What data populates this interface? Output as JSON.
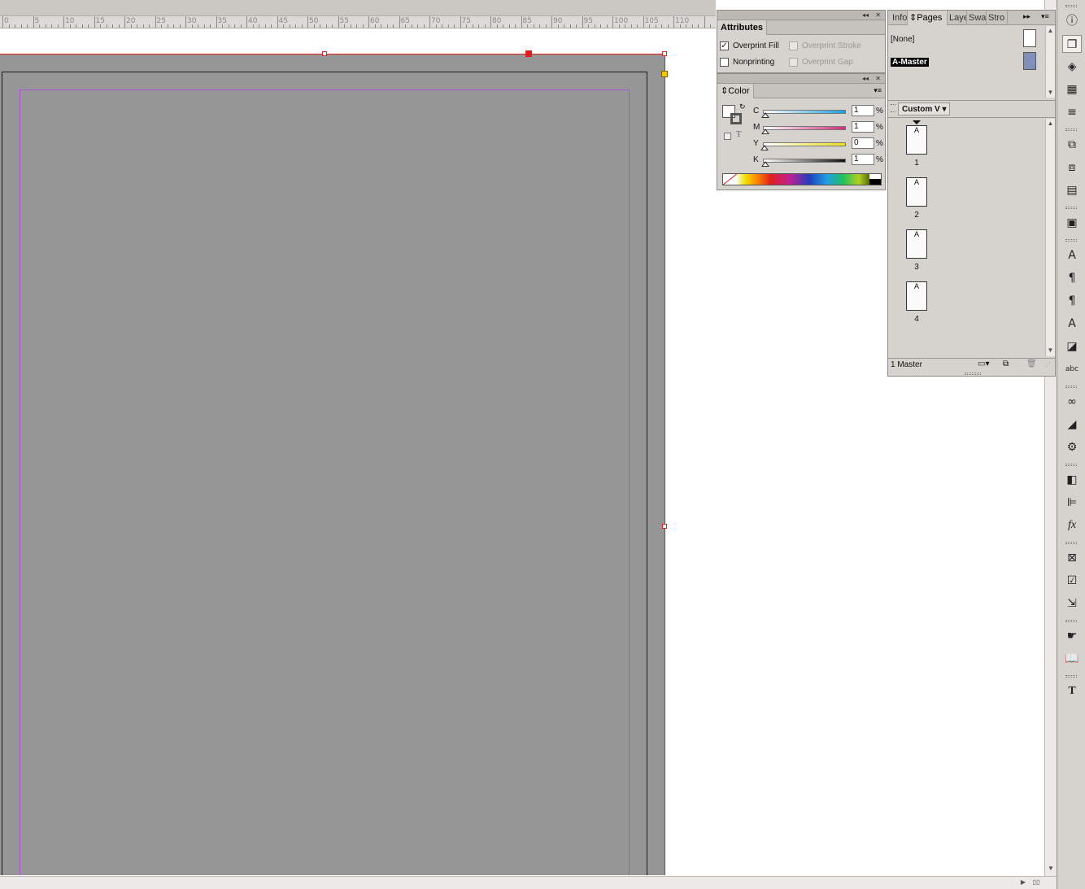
{
  "ruler": {
    "labels": [
      "0",
      "5",
      "10",
      "15",
      "20",
      "25",
      "30",
      "35",
      "40",
      "45",
      "50",
      "55",
      "60",
      "65",
      "70",
      "75",
      "80",
      "85",
      "90",
      "95",
      "100",
      "105",
      "110"
    ]
  },
  "attributes_panel": {
    "title": "Attributes",
    "overprint_fill": "Overprint Fill",
    "overprint_fill_checked": true,
    "overprint_stroke": "Overprint Stroke",
    "nonprinting": "Nonprinting",
    "overprint_gap": "Overprint Gap"
  },
  "color_panel": {
    "title": "Color",
    "channels": [
      {
        "label": "C",
        "value": "1",
        "unit": "%",
        "color": "#1aa0e0"
      },
      {
        "label": "M",
        "value": "1",
        "unit": "%",
        "color": "#d0307a"
      },
      {
        "label": "Y",
        "value": "0",
        "unit": "%",
        "color": "#f0e020"
      },
      {
        "label": "K",
        "value": "1",
        "unit": "%",
        "color": "#111111"
      }
    ]
  },
  "pages_panel": {
    "tabs": [
      "Info",
      "Pages",
      "Layers",
      "Swatches",
      "Stroke"
    ],
    "tab_display": [
      "Info",
      "Pages",
      "Laye",
      "Swa",
      "Stro"
    ],
    "active_tab": "Pages",
    "masters": [
      {
        "name": "[None]",
        "selected": false
      },
      {
        "name": "A-Master",
        "selected": true
      }
    ],
    "view_menu": "Custom V",
    "pages": [
      {
        "letter": "A",
        "number": "1"
      },
      {
        "letter": "A",
        "number": "2"
      },
      {
        "letter": "A",
        "number": "3"
      },
      {
        "letter": "A",
        "number": "4"
      }
    ],
    "status": "1 Master"
  },
  "toolbar": {
    "icons": [
      "info-icon",
      "pages-icon",
      "layers-icon",
      "swatches-grid-icon",
      "stroke-icon",
      "links-icon",
      "page-frames-icon",
      "table-icon",
      "object-styles-icon",
      "character-icon",
      "paragraph-icon",
      "paragraph-styles-icon",
      "character-styles-icon",
      "text-wrap-icon",
      "spell-check-icon",
      "hyperlinks-icon",
      "gradient-icon",
      "interactive-settings-icon",
      "pathfinder-icon",
      "align-icon",
      "effects-icon",
      "preflight-icon",
      "checkbox-icon",
      "export-icon",
      "buttons-icon",
      "book-icon",
      "type-icon"
    ]
  },
  "colors": {
    "bleed": "#e02020",
    "margin": "#b050d8",
    "page_fill": "#969696",
    "master_swatch": "#8090b8"
  }
}
